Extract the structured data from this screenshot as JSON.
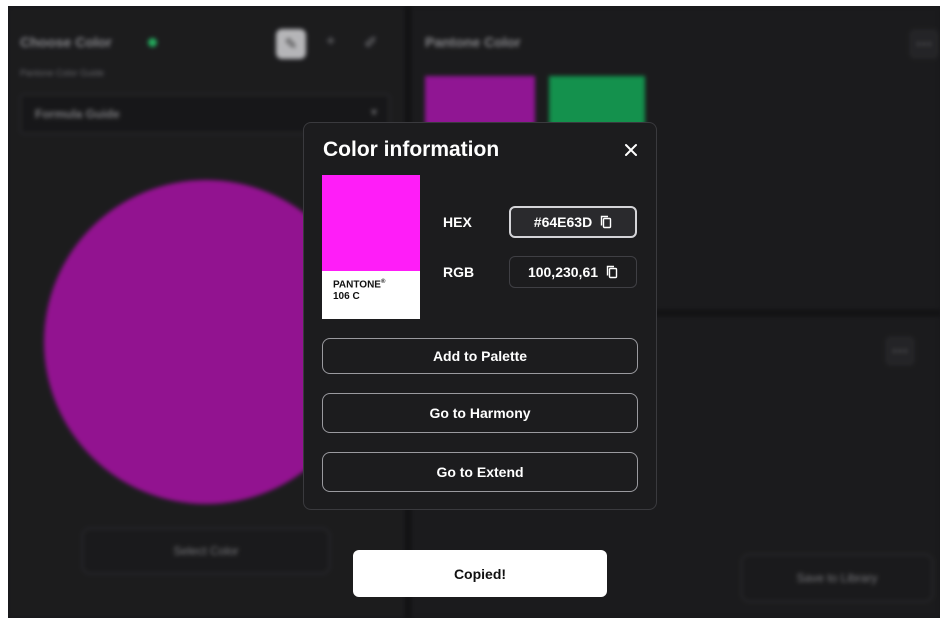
{
  "background": {
    "left_panel": {
      "title": "Choose Color",
      "subtitle": "Pantone Color Guide",
      "guide_select_value": "Formula Guide",
      "select_color_button": "Select Color",
      "circle_color": "#a716a4"
    },
    "right_panel": {
      "title": "Pantone Color",
      "swatch_colors": [
        "#a41aa8",
        "#17a558"
      ],
      "save_button": "Save to Library"
    }
  },
  "modal": {
    "title": "Color information",
    "swatch": {
      "color": "#ff1df8",
      "brand": "PANTONE",
      "registered": "®",
      "code": "106 C"
    },
    "hex": {
      "label": "HEX",
      "value": "#64E63D"
    },
    "rgb": {
      "label": "RGB",
      "value": "100,230,61"
    },
    "buttons": {
      "add_to_palette": "Add to Palette",
      "go_to_harmony": "Go to Harmony",
      "go_to_extend": "Go to Extend"
    }
  },
  "toast": {
    "message": "Copied!"
  },
  "icons": {
    "close": "close-icon",
    "copy": "copy-icon",
    "eyedropper": "eyedropper-icon",
    "plus": "plus-icon",
    "pen": "pen-icon",
    "more": "more-icon"
  }
}
